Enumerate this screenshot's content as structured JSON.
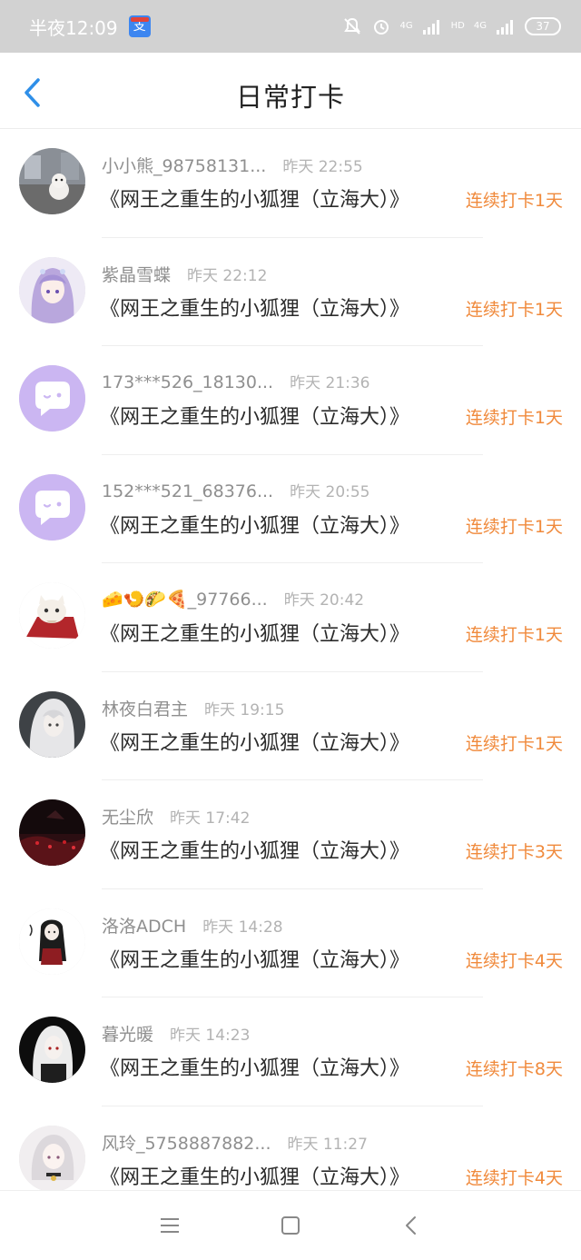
{
  "status_bar": {
    "time": "半夜12:09",
    "net1": "4G",
    "net2": "HD",
    "net3": "4G",
    "battery": "37",
    "app_badge": "支"
  },
  "header": {
    "title": "日常打卡",
    "back_icon": "chevron-left-icon"
  },
  "feed": [
    {
      "name": "小小熊_98758131...",
      "time": "昨天 22:55",
      "book": "《网王之重生的小狐狸（立海大）》",
      "streak": "连续打卡1天",
      "avatar": "photo-dog"
    },
    {
      "name": "紫晶雪蝶",
      "time": "昨天 22:12",
      "book": "《网王之重生的小狐狸（立海大）》",
      "streak": "连续打卡1天",
      "avatar": "anime-purple"
    },
    {
      "name": "173***526_18130...",
      "time": "昨天 21:36",
      "book": "《网王之重生的小狐狸（立海大）》",
      "streak": "连续打卡1天",
      "avatar": "default-chat"
    },
    {
      "name": "152***521_68376...",
      "time": "昨天 20:55",
      "book": "《网王之重生的小狐狸（立海大）》",
      "streak": "连续打卡1天",
      "avatar": "default-chat"
    },
    {
      "name": "🧀🍤🌮🍕_97766...",
      "time": "昨天 20:42",
      "book": "《网王之重生的小狐狸（立海大）》",
      "streak": "连续打卡1天",
      "avatar": "cat-cartoon"
    },
    {
      "name": "林夜白君主",
      "time": "昨天 19:15",
      "book": "《网王之重生的小狐狸（立海大）》",
      "streak": "连续打卡1天",
      "avatar": "anime-white-hair"
    },
    {
      "name": "无尘欣",
      "time": "昨天 17:42",
      "book": "《网王之重生的小狐狸（立海大）》",
      "streak": "连续打卡3天",
      "avatar": "dark-red-scene"
    },
    {
      "name": "洛洛ADCH",
      "time": "昨天 14:28",
      "book": "《网王之重生的小狐狸（立海大）》",
      "streak": "连续打卡4天",
      "avatar": "ink-figure"
    },
    {
      "name": "暮光暖",
      "time": "昨天 14:23",
      "book": "《网王之重生的小狐狸（立海大）》",
      "streak": "连续打卡8天",
      "avatar": "anime-dark"
    },
    {
      "name": "风玲_5758887882...",
      "time": "昨天 11:27",
      "book": "《网王之重生的小狐狸（立海大）》",
      "streak": "连续打卡4天",
      "avatar": "anime-light"
    }
  ],
  "nav_bar": {
    "menu_icon": "menu-icon",
    "home_icon": "home-square-icon",
    "back_icon": "back-triangle-icon"
  },
  "colors": {
    "accent_streak": "#f08a3c",
    "back_blue": "#2f8fe8",
    "default_avatar": "#cbb6f2"
  }
}
